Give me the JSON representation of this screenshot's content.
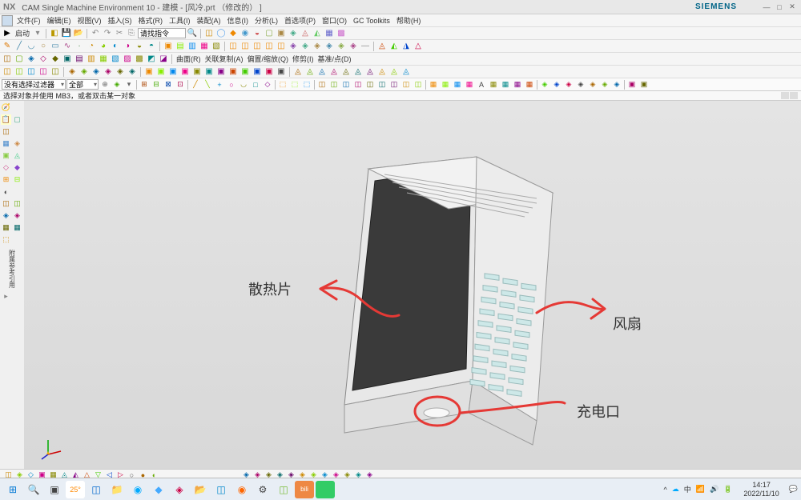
{
  "titlebar": {
    "nx": "NX",
    "title": "CAM Single Machine Environment 10 - 建模 - [风冷.prt （修改的） ]",
    "siemens": "SIEMENS"
  },
  "menubar": {
    "items": [
      "文件(F)",
      "编辑(E)",
      "视图(V)",
      "插入(S)",
      "格式(R)",
      "工具(I)",
      "装配(A)",
      "信息(I)",
      "分析(L)",
      "首选项(P)",
      "窗口(O)",
      "GC Toolkits",
      "帮助(H)"
    ]
  },
  "toolbar1": {
    "start": "启动"
  },
  "toolbar3": {
    "items": [
      "曲面(R)",
      "关联复制(A)",
      "偏置/缩放(Q)",
      "修剪(I)",
      "基准/点(D)"
    ]
  },
  "filterbar": {
    "filter1": "没有选择过滤器",
    "filter2": "全部"
  },
  "status": {
    "msg": "选择对象并使用 MB3，或者双击某一对象"
  },
  "viewport": {
    "label_heatsink": "散热片",
    "label_fan": "风扇",
    "label_charging": "充电口"
  },
  "leftbar": {
    "label": "附属参考引用"
  },
  "taskbar": {
    "cmd": "请找指令",
    "time": "14:17",
    "date": "2022/11/10",
    "ime": "中"
  }
}
